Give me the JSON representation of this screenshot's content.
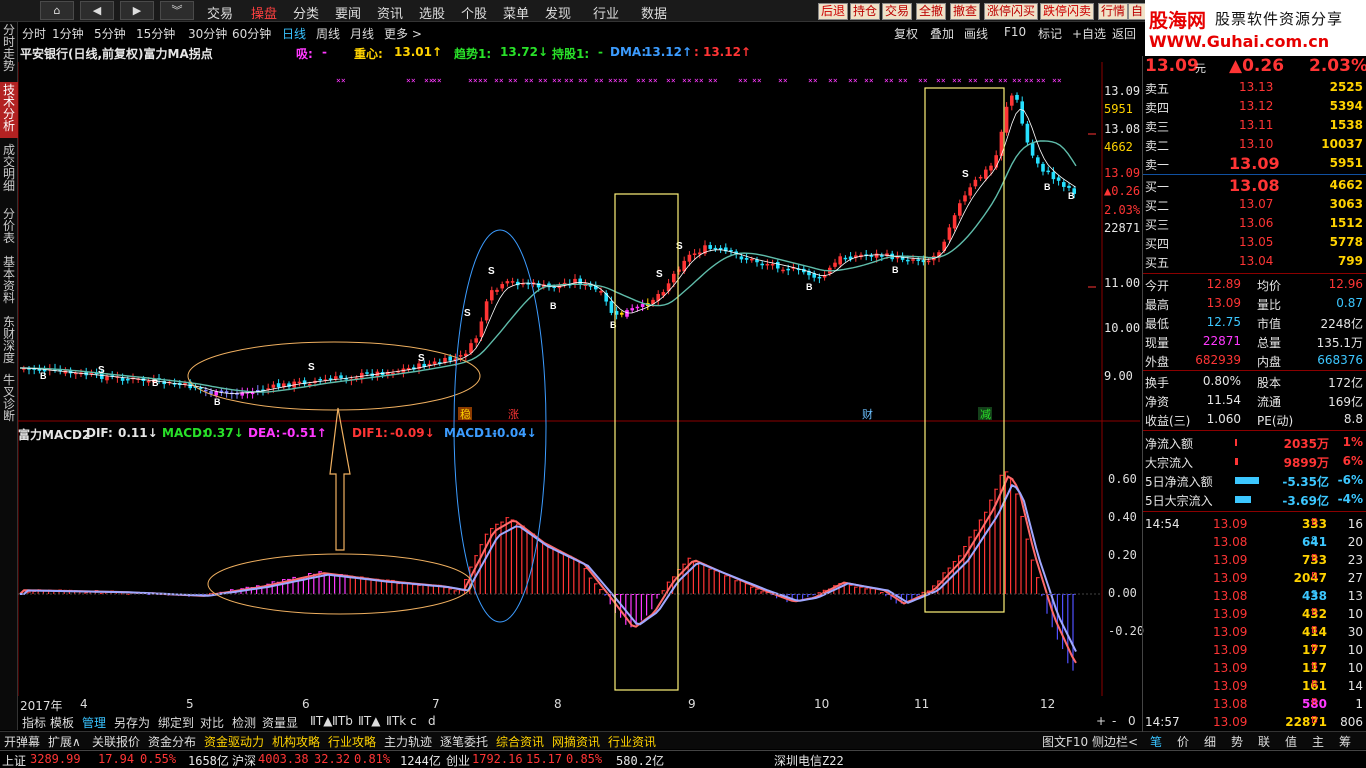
{
  "top": {
    "nav_icons": [
      "home-icon",
      "arrow-left-icon",
      "arrow-right-icon",
      "double-chevron-down-icon"
    ],
    "menu": [
      "交易",
      "操盘",
      "分类",
      "要闻",
      "资讯",
      "选股",
      "个股",
      "菜单",
      "发现",
      "行业",
      "数据"
    ],
    "active_menu": "操盘",
    "quick_buttons": [
      "后退",
      "持仓",
      "交易",
      "全撤",
      "撤查",
      "涨停闪买",
      "跌停闪卖",
      "行情",
      "自"
    ]
  },
  "logo": {
    "line1_a": "股海网",
    "line1_b": "股票软件资源分享",
    "line2": "WWW.Guhai.com.cn"
  },
  "side_tabs": [
    {
      "label": "分时走势",
      "active": false
    },
    {
      "label": "技术分析",
      "active": true
    },
    {
      "label": "成交明细",
      "active": false
    },
    {
      "label": "分价表",
      "active": false
    },
    {
      "label": "基本资料",
      "active": false
    },
    {
      "label": "东财深度",
      "active": false
    },
    {
      "label": "牛叉诊断",
      "active": false
    }
  ],
  "periods": [
    "分时",
    "1分钟",
    "5分钟",
    "15分钟",
    "30分钟",
    "60分钟",
    "日线",
    "周线",
    "月线",
    "更多 >"
  ],
  "active_period": "日线",
  "tools": [
    "复权",
    "叠加",
    "画线",
    "F10",
    "标记",
    "+自选",
    "返回"
  ],
  "title": {
    "stock": "平安银行(日线,前复权)富力MA拐点",
    "xi_label": "吸:",
    "xi_val": "-",
    "zx_label": "重心:",
    "zx_val": "13.01↑",
    "qs_label": "趋势1:",
    "qs_val": "13.72↓",
    "cg_label": "持股1:",
    "cg_val": "-",
    "dma_label": "DMA:",
    "dma_val": "13.12↑",
    "dma_val2": ": 13.12↑"
  },
  "price_axis": [
    {
      "v": "13.09",
      "c": "wht"
    },
    {
      "v": "5951",
      "c": "yel"
    },
    {
      "v": "13.08",
      "c": "wht"
    },
    {
      "v": "4662",
      "c": "yel"
    },
    {
      "v": "13.09",
      "c": "red"
    },
    {
      "v": "▲0.26",
      "c": "red"
    },
    {
      "v": "2.03%",
      "c": "red"
    },
    {
      "v": "22871",
      "c": "wht"
    },
    {
      "v": "11.00",
      "c": "wht"
    },
    {
      "v": "10.00",
      "c": "wht"
    },
    {
      "v": "9.00",
      "c": "wht"
    }
  ],
  "chart_labels": {
    "s": "S",
    "b": "B",
    "wen": "稳",
    "zhang": "涨",
    "cai": "财",
    "jian": "减"
  },
  "macd": {
    "name": "富力MACD2",
    "dif_label": "DIF:",
    "dif": "0.11↓",
    "macd_label": "MACD:",
    "macd": "0.37↓",
    "dea_label": "DEA:",
    "dea": "-0.51↑",
    "dif1_label": "DIF1:",
    "dif1": "-0.09↓",
    "macd1_label": "MACD1:",
    "macd1": "-0.04↓"
  },
  "macd_axis": [
    "0.60",
    "0.40",
    "0.20",
    "0.00",
    "-0.20"
  ],
  "x_axis": [
    "2017年",
    "4",
    "5",
    "6",
    "7",
    "8",
    "9",
    "10",
    "11",
    "12"
  ],
  "bottom_tabs": [
    "指标",
    "模板",
    "管理",
    "另存为",
    "绑定到",
    "对比",
    "检测",
    "资量显",
    "ⅡT▲",
    "ⅡTb",
    "ⅡT▲",
    "ⅡTk",
    "c",
    "d"
  ],
  "bottom_right": [
    "+",
    "-",
    "0"
  ],
  "fn_bar": [
    "开弹幕",
    "扩展∧",
    "关联报价",
    "资金分布",
    "资金驱动力",
    "机构攻略",
    "行业攻略",
    "主力轨迹",
    "逐笔委托",
    "综合资讯",
    "网摘资讯",
    "行业资讯"
  ],
  "fn_right": [
    "图文F10",
    "侧边栏<"
  ],
  "rp_tabs": [
    "笔",
    "价",
    "细",
    "势",
    "联",
    "值",
    "主",
    "筹"
  ],
  "status": {
    "sh_label": "上证",
    "sh": "3289.99",
    "sh_chg": "17.94",
    "sh_pct": "0.55%",
    "sh_amt": "1658亿",
    "hs_label": "沪深",
    "hs": "4003.38",
    "hs_chg": "32.32",
    "hs_pct": "0.81%",
    "hs_amt": "1244亿",
    "cy_label": "创业",
    "cy": "1792.16",
    "cy_chg": "15.17",
    "cy_pct": "0.85%",
    "cy_amt": "580.2亿",
    "news": "深圳电信Z22"
  },
  "quote": {
    "price": "13.09",
    "unit": "元",
    "chg": "▲0.26",
    "pct": "2.03%"
  },
  "asks": [
    {
      "l": "卖五",
      "p": "13.13",
      "v": "2525"
    },
    {
      "l": "卖四",
      "p": "13.12",
      "v": "5394"
    },
    {
      "l": "卖三",
      "p": "13.11",
      "v": "1538"
    },
    {
      "l": "卖二",
      "p": "13.10",
      "v": "10037"
    },
    {
      "l": "卖一",
      "p": "13.09",
      "v": "5951"
    }
  ],
  "bids": [
    {
      "l": "买一",
      "p": "13.08",
      "v": "4662"
    },
    {
      "l": "买二",
      "p": "13.07",
      "v": "3063"
    },
    {
      "l": "买三",
      "p": "13.06",
      "v": "1512"
    },
    {
      "l": "买四",
      "p": "13.05",
      "v": "5778"
    },
    {
      "l": "买五",
      "p": "13.04",
      "v": "799"
    }
  ],
  "stats": [
    {
      "a": "今开",
      "av": "12.89",
      "ac": "red",
      "b": "均价",
      "bv": "12.96",
      "bc": "red"
    },
    {
      "a": "最高",
      "av": "13.09",
      "ac": "red",
      "b": "量比",
      "bv": "0.87",
      "bc": "cyn"
    },
    {
      "a": "最低",
      "av": "12.75",
      "ac": "cyn",
      "b": "市值",
      "bv": "2248亿",
      "bc": "wht"
    },
    {
      "a": "现量",
      "av": "22871",
      "ac": "mag",
      "b": "总量",
      "bv": "135.1万",
      "bc": "wht"
    },
    {
      "a": "外盘",
      "av": "682939",
      "ac": "red",
      "b": "内盘",
      "bv": "668376",
      "bc": "cyn"
    },
    {
      "a": "换手",
      "av": "0.80%",
      "ac": "wht",
      "b": "股本",
      "bv": "172亿",
      "bc": "wht"
    },
    {
      "a": "净资",
      "av": "11.54",
      "ac": "wht",
      "b": "流通",
      "bv": "169亿",
      "bc": "wht"
    },
    {
      "a": "收益(三)",
      "av": "1.060",
      "ac": "wht",
      "b": "PE(动)",
      "bv": "8.8",
      "bc": "wht"
    }
  ],
  "flows": [
    {
      "l": "净流入额",
      "v": "2035万",
      "p": "1%",
      "c": "red",
      "bar": 0.05
    },
    {
      "l": "大宗流入",
      "v": "9899万",
      "p": "6%",
      "c": "red",
      "bar": 0.08
    },
    {
      "l": "5日净流入额",
      "v": "-5.35亿",
      "p": "-6%",
      "c": "cyn",
      "bar": 0.6
    },
    {
      "l": "5日大宗流入",
      "v": "-3.69亿",
      "p": "-4%",
      "c": "cyn",
      "bar": 0.4
    }
  ],
  "ticks": [
    {
      "t": "14:54",
      "p": "13.09",
      "v": "333",
      "s": "B",
      "n": "16"
    },
    {
      "t": "",
      "p": "13.08",
      "v": "641",
      "s": "S",
      "n": "20"
    },
    {
      "t": "",
      "p": "13.09",
      "v": "733",
      "s": "B",
      "n": "23"
    },
    {
      "t": "",
      "p": "13.09",
      "v": "2047",
      "s": "B",
      "n": "27"
    },
    {
      "t": "",
      "p": "13.08",
      "v": "438",
      "s": "S",
      "n": "13"
    },
    {
      "t": "",
      "p": "13.09",
      "v": "432",
      "s": "B",
      "n": "10"
    },
    {
      "t": "",
      "p": "13.09",
      "v": "414",
      "s": "B",
      "n": "30"
    },
    {
      "t": "",
      "p": "13.09",
      "v": "177",
      "s": "B",
      "n": "10"
    },
    {
      "t": "",
      "p": "13.09",
      "v": "117",
      "s": "B",
      "n": "10"
    },
    {
      "t": "",
      "p": "13.09",
      "v": "161",
      "s": "B",
      "n": "14"
    },
    {
      "t": "",
      "p": "13.08",
      "v": "580",
      "s": "B",
      "n": "1"
    },
    {
      "t": "14:57",
      "p": "13.09",
      "v": "22871",
      "s": "B",
      "n": "806"
    }
  ]
}
